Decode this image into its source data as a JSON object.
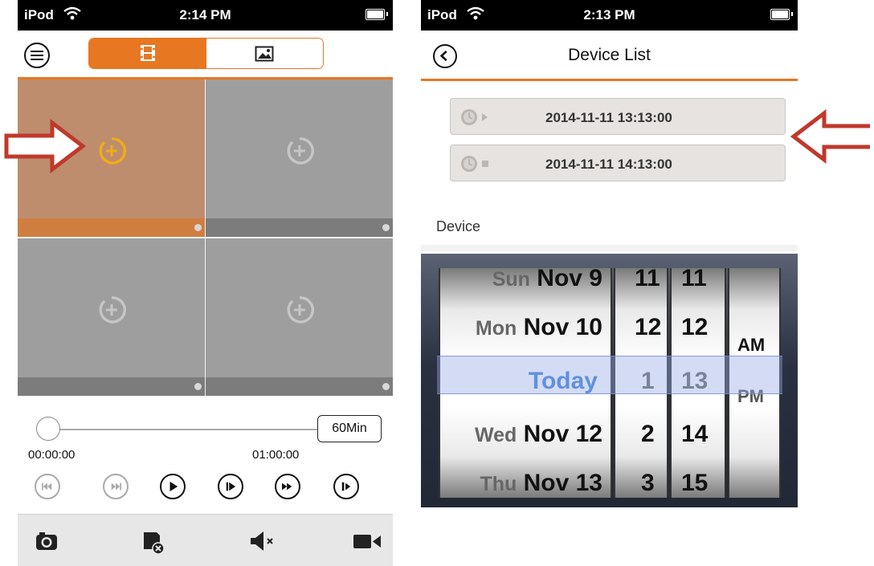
{
  "left_screen": {
    "status": {
      "carrier": "iPod",
      "time": "2:14 PM"
    },
    "header": {
      "menu_icon": "hamburger-icon",
      "tabs": [
        {
          "icon": "film-icon",
          "selected": true
        },
        {
          "icon": "picture-icon",
          "selected": false
        }
      ]
    },
    "grid": {
      "cells": [
        {
          "icon": "add-channel-icon",
          "active": true
        },
        {
          "icon": "add-channel-icon",
          "active": false
        },
        {
          "icon": "add-channel-icon",
          "active": false
        },
        {
          "icon": "add-channel-icon",
          "active": false
        }
      ]
    },
    "timeline": {
      "start": "00:00:00",
      "end": "01:00:00",
      "duration_button": "60Min",
      "position": 0.0
    },
    "playback_buttons": [
      "skip-back-icon",
      "skip-forward-icon",
      "play-icon",
      "step-forward-icon",
      "fast-forward-icon",
      "frame-forward-icon"
    ],
    "toolbar": [
      "camera-icon",
      "delete-record-icon",
      "mute-icon",
      "video-record-icon"
    ]
  },
  "right_screen": {
    "status": {
      "carrier": "iPod",
      "time": "2:13 PM"
    },
    "header": {
      "title": "Device List",
      "back_icon": "chevron-left-icon"
    },
    "start_time": "2014-11-11 13:13:00",
    "end_time": "2014-11-11 14:13:00",
    "device_label": "Device",
    "picker": {
      "dates": [
        {
          "day": "Sun",
          "date": "Nov 9"
        },
        {
          "day": "Mon",
          "date": "Nov 10"
        },
        {
          "day": "",
          "date": "Today"
        },
        {
          "day": "Wed",
          "date": "Nov 12"
        },
        {
          "day": "Thu",
          "date": "Nov 13"
        }
      ],
      "hours": [
        "11",
        "12",
        "1",
        "2",
        "3"
      ],
      "minutes": [
        "11",
        "12",
        "13",
        "14",
        "15"
      ],
      "ampm": [
        "",
        "AM",
        "PM",
        "",
        ""
      ],
      "selected_index": 2
    }
  },
  "colors": {
    "accent": "#e87722",
    "arrow": "#c0392b",
    "picker_selected": "#3b7fd6"
  }
}
